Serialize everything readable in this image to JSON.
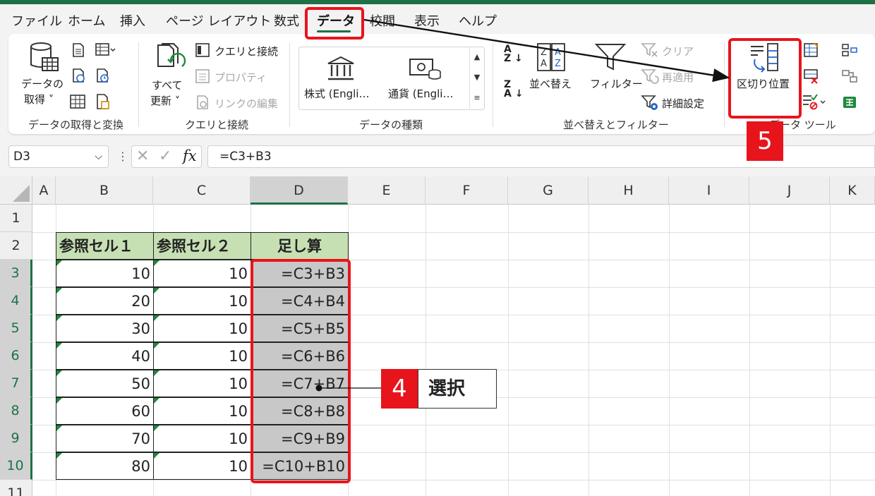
{
  "menu": {
    "tabs": [
      "ファイル",
      "ホーム",
      "挿入",
      "ページ レイアウト",
      "数式",
      "データ",
      "校閲",
      "表示",
      "ヘルプ"
    ],
    "active_tab": "データ"
  },
  "ribbon": {
    "get_data": {
      "line1": "データの",
      "line2": "取得 ˅"
    },
    "refresh_all": {
      "line1": "すべて",
      "line2": "更新 ˅"
    },
    "queries": {
      "queries_connections": "クエリと接続",
      "properties": "プロパティ",
      "edit_links": "リンクの編集"
    },
    "data_types": {
      "stocks": "株式 (Engli…",
      "currencies": "通貨 (Engli…"
    },
    "sort_filter": {
      "sort": "並べ替え",
      "filter": "フィルター",
      "clear": "クリア",
      "reapply": "再適用",
      "advanced": "詳細設定"
    },
    "data_tools": {
      "text_to_columns": "区切り位置",
      "group_label_partial": "データ ツール"
    },
    "group_labels": {
      "get_transform": "データの取得と変換",
      "queries_connections": "クエリと接続",
      "data_types": "データの種類",
      "sort_filter": "並べ替えとフィルター"
    }
  },
  "formula_bar": {
    "name_box": "D3",
    "formula": "=C3+B3",
    "fx_label": "fx"
  },
  "sheet": {
    "columns": [
      "A",
      "B",
      "C",
      "D",
      "E",
      "F",
      "G",
      "H",
      "I",
      "J",
      "K"
    ],
    "rows": [
      "1",
      "2",
      "3",
      "4",
      "5",
      "6",
      "7",
      "8",
      "9",
      "10",
      "11"
    ],
    "headers": [
      "参照セル１",
      "参照セル２",
      "足し算"
    ],
    "table": [
      {
        "b": "10",
        "c": "10",
        "d": "=C3+B3"
      },
      {
        "b": "20",
        "c": "10",
        "d": "=C4+B4"
      },
      {
        "b": "30",
        "c": "10",
        "d": "=C5+B5"
      },
      {
        "b": "40",
        "c": "10",
        "d": "=C6+B6"
      },
      {
        "b": "50",
        "c": "10",
        "d": "=C7+B7"
      },
      {
        "b": "60",
        "c": "10",
        "d": "=C8+B8"
      },
      {
        "b": "70",
        "c": "10",
        "d": "=C9+B9"
      },
      {
        "b": "80",
        "c": "10",
        "d": "=C10+B10"
      }
    ]
  },
  "annotations": {
    "step4": {
      "number": "4",
      "label": "選択"
    },
    "step5": {
      "number": "5"
    }
  },
  "colors": {
    "accent_green": "#1e7145",
    "highlight_red": "#e8141c",
    "header_fill": "#c6e0b4",
    "selection_fill": "#c8c8c8"
  }
}
